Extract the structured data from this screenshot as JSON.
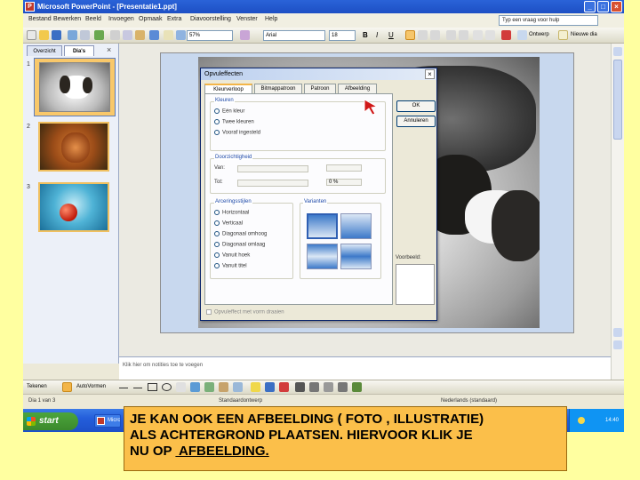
{
  "window": {
    "title": "Microsoft PowerPoint - [Presentatie1.ppt]",
    "app_icon": "powerpoint-icon"
  },
  "menu": {
    "items": [
      "Bestand",
      "Bewerken",
      "Beeld",
      "Invoegen",
      "Opmaak",
      "Extra",
      "Diavoorstelling",
      "Venster",
      "Help"
    ],
    "help_placeholder": "Typ een vraag voor hulp"
  },
  "toolbar": {
    "zoom": "57%",
    "font": "Arial",
    "size": "18",
    "bold": "B",
    "italic": "I",
    "underline": "U",
    "design_label": "Ontwerp",
    "new_slide_label": "Nieuwe dia"
  },
  "left_pane": {
    "tabs": [
      "Overzicht",
      "Dia's"
    ],
    "close": "×",
    "slides": [
      {
        "number": "1"
      },
      {
        "number": "2"
      },
      {
        "number": "3"
      }
    ]
  },
  "dialog": {
    "title": "Opvuleffecten",
    "close": "×",
    "tabs": [
      "Kleurverloop",
      "Bitmappatroon",
      "Patroon",
      "Afbeelding"
    ],
    "buttons": {
      "ok": "OK",
      "cancel": "Annuleren"
    },
    "colors_group": "Kleuren",
    "color_options": [
      "Eén kleur",
      "Twee kleuren",
      "Vooraf ingesteld"
    ],
    "transparency_group": "Doorzichtigheid",
    "transparency_from": "Van:",
    "transparency_to": "Tot:",
    "transparency_value": "0 %",
    "shading_group": "Arceringsstijlen",
    "shading_options": [
      "Horizontaal",
      "Verticaal",
      "Diagonaal omhoog",
      "Diagonaal omlaag",
      "Vanuit hoek",
      "Vanuit titel"
    ],
    "variants_group": "Varianten",
    "sample_label": "Voorbeeld:",
    "rotate_checkbox": "Opvuleffect met vorm draaien"
  },
  "notes": {
    "placeholder": "Klik hier om notities toe te voegen"
  },
  "draw_toolbar": {
    "draw_label": "Tekenen",
    "autoshapes_label": "AutoVormen"
  },
  "statusbar": {
    "slide_info": "Dia 1 van 3",
    "design": "Standaardontwerp",
    "language": "Nederlands (standaard)"
  },
  "taskbar": {
    "start_label": "start",
    "task1": "Micro",
    "clock": "14:40"
  },
  "caption": {
    "line1": "JE KAN OOK EEN AFBEELDING ( FOTO , ILLUSTRATIE)",
    "line2": "ALS ACHTERGROND PLAATSEN. HIERVOOR KLIK JE",
    "line3_prefix": "NU OP ",
    "line3_link": " AFBEELDING."
  }
}
